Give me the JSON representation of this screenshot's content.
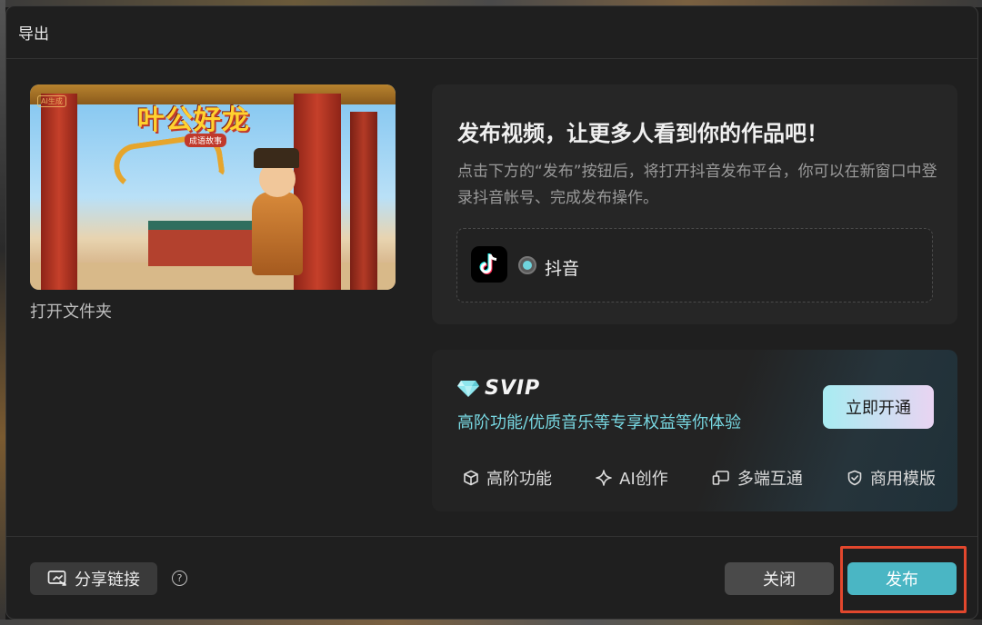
{
  "dialog": {
    "title": "导出"
  },
  "preview": {
    "open_folder_label": "打开文件夹",
    "art_title": "叶公好龙",
    "art_subtitle": "成语故事",
    "ai_tag": "AI生成"
  },
  "publish_card": {
    "heading": "发布视频，让更多人看到你的作品吧！",
    "description": "点击下方的“发布”按钮后，将打开抖音发布平台，你可以在新窗口中登录抖音帐号、完成发布操作。",
    "platform": {
      "label": "抖音",
      "selected": true,
      "icon": "tiktok-icon"
    }
  },
  "svip": {
    "badge": "SVIP",
    "description": "高阶功能/优质音乐等专享权益等你体验",
    "cta_label": "立即开通",
    "features": [
      {
        "label": "高阶功能",
        "icon": "cube-icon"
      },
      {
        "label": "AI创作",
        "icon": "sparkle-icon"
      },
      {
        "label": "多端互通",
        "icon": "devices-icon"
      },
      {
        "label": "商用模版",
        "icon": "shield-check-icon"
      }
    ]
  },
  "footer": {
    "share_label": "分享链接",
    "help_symbol": "?",
    "close_label": "关闭",
    "publish_label": "发布"
  },
  "colors": {
    "accent": "#4ab6c4",
    "svip_text": "#78d8e2",
    "highlight": "#e2472d"
  }
}
